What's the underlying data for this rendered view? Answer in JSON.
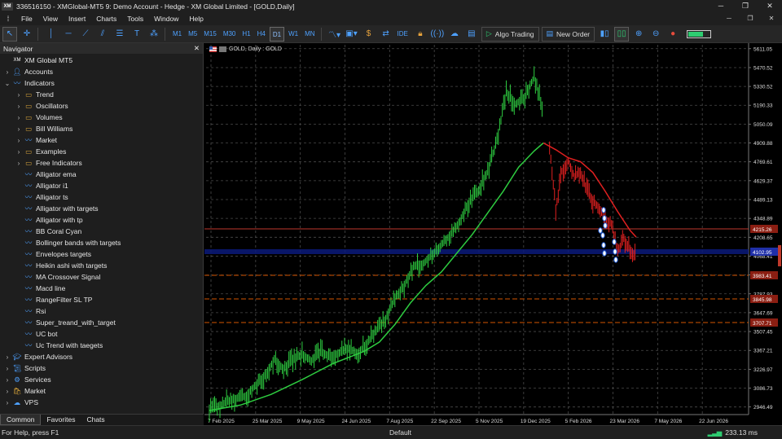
{
  "window": {
    "title": "336516150 - XMGlobal-MT5 9: Demo Account - Hedge - XM Global Limited - [GOLD,Daily]",
    "logo": "XM"
  },
  "menu": [
    "File",
    "View",
    "Insert",
    "Charts",
    "Tools",
    "Window",
    "Help"
  ],
  "toolbar": {
    "timeframes": [
      "M1",
      "M5",
      "M15",
      "M30",
      "H1",
      "H4",
      "D1",
      "W1",
      "MN"
    ],
    "selected_timeframe": "D1",
    "ide_label": "IDE",
    "algo_trading_label": "Algo Trading",
    "new_order_label": "New Order"
  },
  "navigator": {
    "title": "Navigator",
    "close": "✕",
    "items": [
      {
        "label": "XM Global MT5",
        "icon": "terminal-icon",
        "level": 0,
        "arrow": ""
      },
      {
        "label": "Accounts",
        "icon": "accounts-icon",
        "level": 0,
        "arrow": "›"
      },
      {
        "label": "Indicators",
        "icon": "indicator-icon",
        "level": 0,
        "arrow": "⌄"
      },
      {
        "label": "Trend",
        "icon": "folder-icon",
        "level": 1,
        "arrow": "›"
      },
      {
        "label": "Oscillators",
        "icon": "folder-icon",
        "level": 1,
        "arrow": "›"
      },
      {
        "label": "Volumes",
        "icon": "folder-icon",
        "level": 1,
        "arrow": "›"
      },
      {
        "label": "Bill Williams",
        "icon": "folder-icon",
        "level": 1,
        "arrow": "›"
      },
      {
        "label": "Market",
        "icon": "indicator-icon",
        "level": 1,
        "arrow": "›"
      },
      {
        "label": "Examples",
        "icon": "folder-icon",
        "level": 1,
        "arrow": "›"
      },
      {
        "label": "Free Indicators",
        "icon": "folder-icon",
        "level": 1,
        "arrow": "›"
      },
      {
        "label": "Alligator ema",
        "icon": "indicator-icon",
        "level": 1,
        "arrow": ""
      },
      {
        "label": "Alligator i1",
        "icon": "indicator-icon",
        "level": 1,
        "arrow": ""
      },
      {
        "label": "Alligator ts",
        "icon": "indicator-icon",
        "level": 1,
        "arrow": ""
      },
      {
        "label": "Alligator with targets",
        "icon": "indicator-icon",
        "level": 1,
        "arrow": ""
      },
      {
        "label": "Alligator with tp",
        "icon": "indicator-icon",
        "level": 1,
        "arrow": ""
      },
      {
        "label": "BB Coral Cyan",
        "icon": "indicator-icon",
        "level": 1,
        "arrow": ""
      },
      {
        "label": "Bollinger bands with targets",
        "icon": "indicator-icon",
        "level": 1,
        "arrow": ""
      },
      {
        "label": "Envelopes targets",
        "icon": "indicator-icon",
        "level": 1,
        "arrow": ""
      },
      {
        "label": "Heikin ashi with targets",
        "icon": "indicator-icon",
        "level": 1,
        "arrow": ""
      },
      {
        "label": "MA Crossover Signal",
        "icon": "indicator-icon",
        "level": 1,
        "arrow": ""
      },
      {
        "label": "Macd line",
        "icon": "indicator-icon",
        "level": 1,
        "arrow": ""
      },
      {
        "label": "RangeFilter SL TP",
        "icon": "indicator-icon",
        "level": 1,
        "arrow": ""
      },
      {
        "label": "Rsi",
        "icon": "indicator-icon",
        "level": 1,
        "arrow": ""
      },
      {
        "label": "Super_treand_with_target",
        "icon": "indicator-icon",
        "level": 1,
        "arrow": ""
      },
      {
        "label": "UC bot",
        "icon": "indicator-icon",
        "level": 1,
        "arrow": ""
      },
      {
        "label": "Uc Trend with taegets",
        "icon": "indicator-icon",
        "level": 1,
        "arrow": ""
      },
      {
        "label": "Expert Advisors",
        "icon": "expert-icon",
        "level": 0,
        "arrow": "›"
      },
      {
        "label": "Scripts",
        "icon": "script-icon",
        "level": 0,
        "arrow": "›"
      },
      {
        "label": "Services",
        "icon": "gear-icon",
        "level": 0,
        "arrow": "›"
      },
      {
        "label": "Market",
        "icon": "market-icon",
        "level": 0,
        "arrow": "›"
      },
      {
        "label": "VPS",
        "icon": "vps-icon",
        "level": 0,
        "arrow": "›"
      }
    ],
    "tabs": [
      "Common",
      "Favorites",
      "Chats"
    ],
    "active_tab": "Common"
  },
  "chart": {
    "label": "GOLD, Daily : GOLD"
  },
  "chart_data": {
    "type": "candlestick",
    "symbol": "GOLD",
    "timeframe": "Daily",
    "y_ticks": [
      5611.05,
      5470.52,
      5330.52,
      5190.33,
      5050.09,
      4909.88,
      4769.61,
      4629.37,
      4489.13,
      4348.89,
      4208.65,
      4068.41,
      3928.17,
      3787.93,
      3647.69,
      3507.45,
      3367.21,
      3226.97,
      3086.73,
      2946.49
    ],
    "ylim": [
      2890,
      5640
    ],
    "x_ticks": [
      "7 Feb 2025",
      "25 Mar 2025",
      "9 May 2025",
      "24 Jun 2025",
      "7 Aug 2025",
      "22 Sep 2025",
      "5 Nov 2025",
      "19 Dec 2025",
      "5 Feb 2026",
      "23 Mar 2026",
      "7 May 2026",
      "22 Jun 2026"
    ],
    "price_labels": [
      {
        "value": "4215.26",
        "kind": "red-line"
      },
      {
        "value": "4102.95",
        "kind": "blue-band"
      },
      {
        "value": "3983.41",
        "kind": "orange-line"
      },
      {
        "value": "3845.98",
        "kind": "orange-line"
      },
      {
        "value": "3707.71",
        "kind": "orange-line"
      }
    ],
    "series": [
      {
        "name": "",
        "color": "#2ecc40",
        "kind": "candles",
        "points": [
          [
            0,
            2930
          ],
          [
            3,
            2950
          ],
          [
            6,
            2990
          ],
          [
            9,
            3010
          ],
          [
            12,
            3030
          ],
          [
            15,
            3110
          ],
          [
            18,
            3180
          ],
          [
            21,
            3300
          ],
          [
            24,
            3230
          ],
          [
            27,
            3300
          ],
          [
            30,
            3340
          ],
          [
            33,
            3290
          ],
          [
            36,
            3360
          ],
          [
            39,
            3320
          ],
          [
            42,
            3350
          ],
          [
            45,
            3380
          ],
          [
            48,
            3345
          ],
          [
            51,
            3420
          ],
          [
            54,
            3520
          ],
          [
            57,
            3600
          ],
          [
            60,
            3760
          ],
          [
            63,
            3850
          ],
          [
            66,
            3990
          ],
          [
            69,
            4010
          ],
          [
            72,
            4080
          ],
          [
            75,
            4150
          ],
          [
            78,
            4230
          ],
          [
            81,
            4330
          ],
          [
            84,
            4470
          ],
          [
            87,
            4560
          ],
          [
            90,
            4700
          ],
          [
            93,
            4930
          ],
          [
            96,
            5290
          ],
          [
            99,
            5200
          ],
          [
            102,
            5250
          ],
          [
            105,
            5400
          ],
          [
            108,
            5150
          ]
        ]
      },
      {
        "name": "",
        "color": "#e02020",
        "kind": "candles",
        "points": [
          [
            110,
            4890
          ],
          [
            112,
            4420
          ],
          [
            114,
            4700
          ],
          [
            116,
            4780
          ],
          [
            118,
            4660
          ],
          [
            120,
            4700
          ],
          [
            122,
            4560
          ],
          [
            124,
            4480
          ],
          [
            126,
            4430
          ],
          [
            128,
            4340
          ],
          [
            130,
            4310
          ],
          [
            132,
            4100
          ],
          [
            134,
            4200
          ],
          [
            136,
            4120
          ],
          [
            138,
            4060
          ]
        ]
      },
      {
        "name": "",
        "color": "#2ecc40",
        "kind": "moving-average",
        "points": [
          [
            0,
            2920
          ],
          [
            10,
            2960
          ],
          [
            20,
            3040
          ],
          [
            30,
            3150
          ],
          [
            40,
            3270
          ],
          [
            50,
            3360
          ],
          [
            55,
            3430
          ],
          [
            60,
            3560
          ],
          [
            65,
            3720
          ],
          [
            70,
            3850
          ],
          [
            75,
            3950
          ],
          [
            80,
            4090
          ],
          [
            85,
            4230
          ],
          [
            90,
            4390
          ],
          [
            95,
            4550
          ],
          [
            100,
            4730
          ],
          [
            105,
            4850
          ],
          [
            108,
            4910
          ]
        ]
      },
      {
        "name": "",
        "color": "#e02020",
        "kind": "moving-average",
        "points": [
          [
            108,
            4910
          ],
          [
            112,
            4860
          ],
          [
            116,
            4800
          ],
          [
            120,
            4770
          ],
          [
            124,
            4690
          ],
          [
            128,
            4550
          ],
          [
            132,
            4400
          ],
          [
            136,
            4260
          ],
          [
            138,
            4210
          ]
        ]
      }
    ]
  },
  "status": {
    "help": "For Help, press F1",
    "profile": "Default",
    "ping": "233.13 ms"
  }
}
